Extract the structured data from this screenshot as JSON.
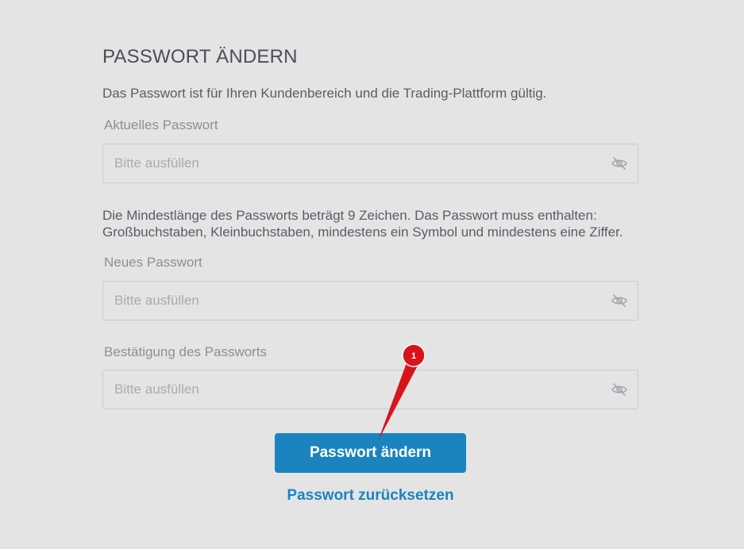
{
  "form": {
    "title": "PASSWORT ÄNDERN",
    "intro": "Das Passwort ist für Ihren Kundenbereich und die Trading-Plattform gültig.",
    "current_password": {
      "label": "Aktuelles Passwort",
      "placeholder": "Bitte ausfüllen",
      "value": ""
    },
    "rules": "Die Mindestlänge des Passworts beträgt 9 Zeichen. Das Passwort muss enthalten: Großbuchstaben, Kleinbuchstaben, mindestens ein Symbol und mindestens eine Ziffer.",
    "new_password": {
      "label": "Neues Passwort",
      "placeholder": "Bitte ausfüllen",
      "value": ""
    },
    "confirm_password": {
      "label": "Bestätigung des Passworts",
      "placeholder": "Bitte ausfüllen",
      "value": ""
    },
    "submit_label": "Passwort ändern",
    "reset_link": "Passwort zurücksetzen"
  },
  "annotation": {
    "badge_number": "1"
  },
  "icons": {
    "visibility_toggle": "eye-off-icon"
  },
  "colors": {
    "background": "#e4e4e5",
    "accent": "#1b84bf",
    "annotation_red": "#d8141b"
  }
}
